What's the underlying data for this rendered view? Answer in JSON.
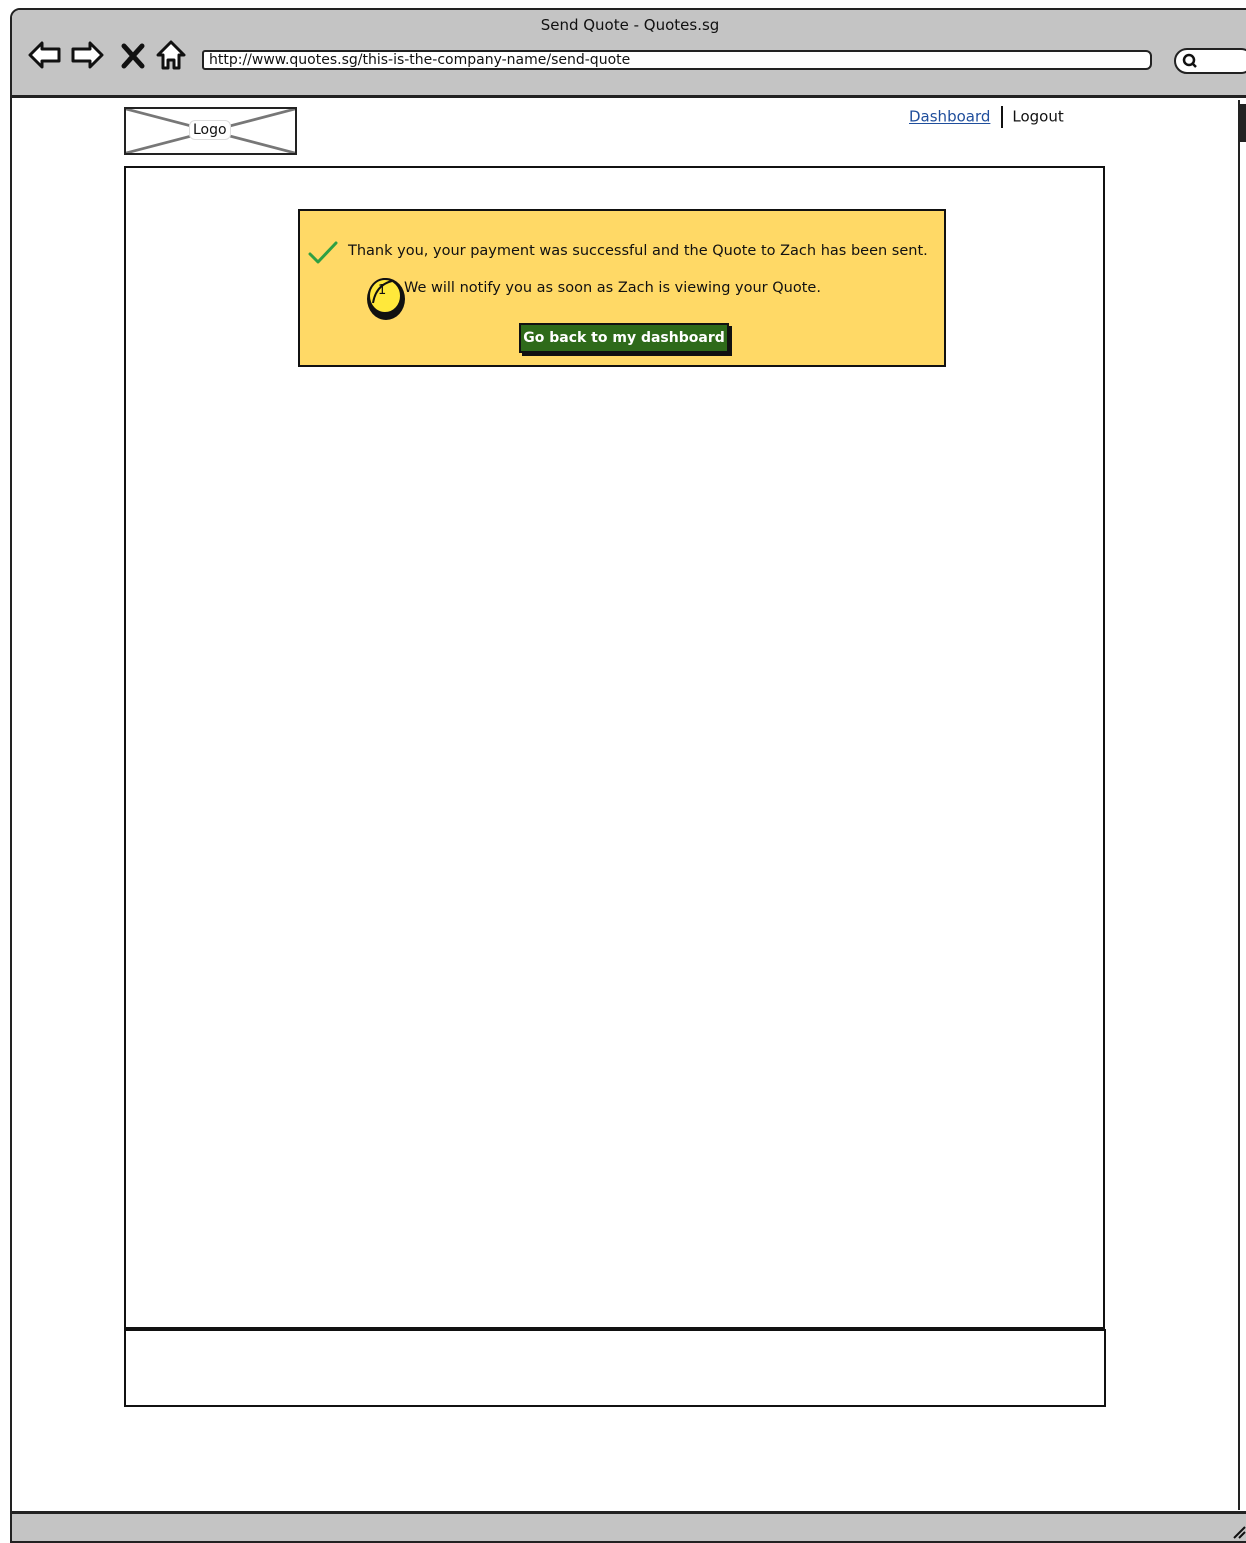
{
  "window": {
    "title": "Send Quote - Quotes.sg",
    "url": "http://www.quotes.sg/this-is-the-company-name/send-quote"
  },
  "header": {
    "logo_label": "Logo",
    "links": {
      "dashboard": "Dashboard",
      "logout": "Logout"
    }
  },
  "alert": {
    "message_primary": "Thank you, your payment was successful and the Quote to Zach has been sent.",
    "message_secondary": "We will notify you as soon as Zach is viewing your Quote.",
    "annotation_number": "1",
    "button_label": "Go back to my dashboard"
  },
  "colors": {
    "alert_background": "#ffd966",
    "button_background": "#2e6a1a",
    "checkmark": "#2ea043",
    "link": "#1f4e9c",
    "chrome": "#c4c4c4"
  },
  "icons": [
    "back-arrow-icon",
    "forward-arrow-icon",
    "stop-x-icon",
    "home-icon",
    "search-icon",
    "checkmark-icon",
    "annotation-marker-icon"
  ]
}
